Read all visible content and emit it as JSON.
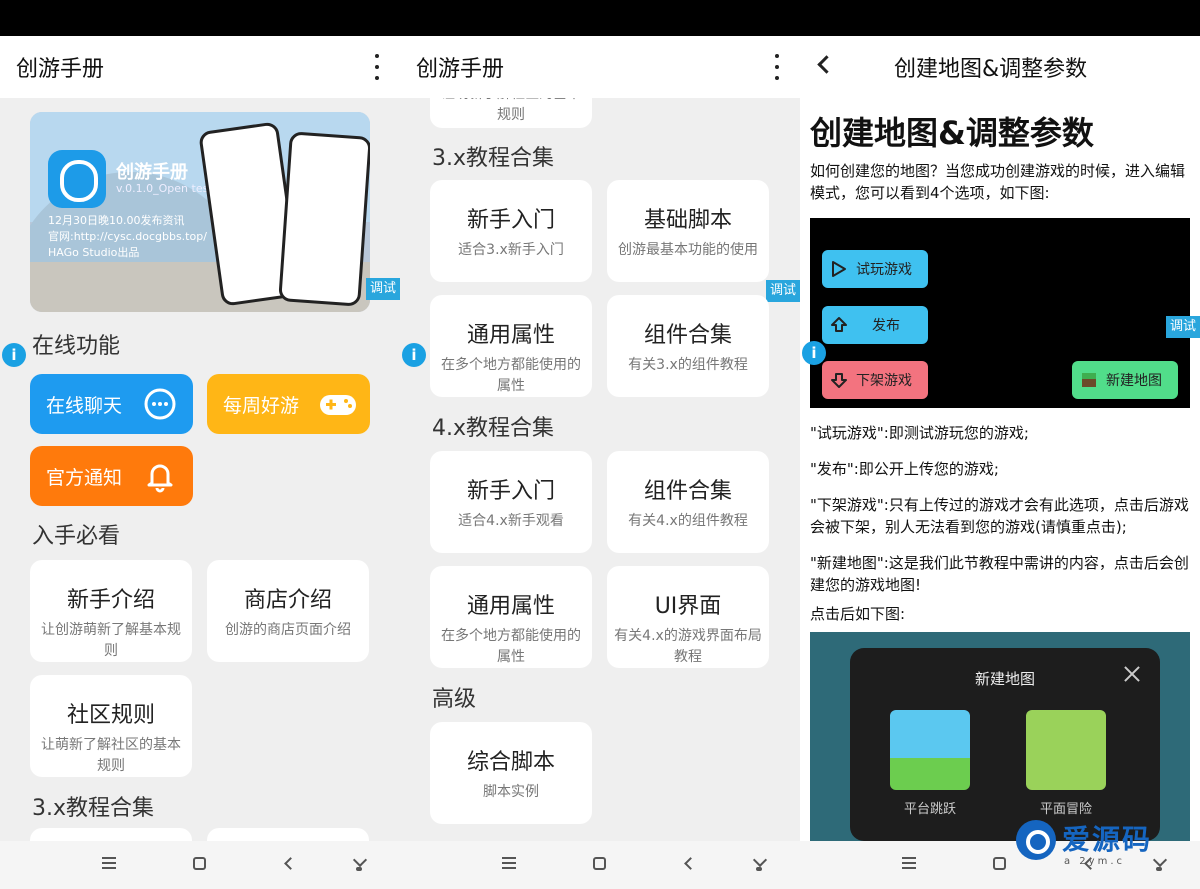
{
  "panel1": {
    "title": "创游手册",
    "banner": {
      "app_name": "创游手册",
      "version": "v.0.1.0_Open test",
      "notice": "12月30日晚10.00发布资讯",
      "site": "官网:http://cysc.docgbbs.top/",
      "studio": "HAGo Studio出品"
    },
    "debug_tag": "调试",
    "online_title": "在线功能",
    "buttons": [
      {
        "label": "在线聊天",
        "color": "#1e9bf0"
      },
      {
        "label": "每周好游",
        "color": "#ffb616"
      },
      {
        "label": "官方通知",
        "color": "#ff7a0c"
      }
    ],
    "must_see_title": "入手必看",
    "cards": [
      {
        "title": "新手介绍",
        "sub": "让创游萌新了解基本规则"
      },
      {
        "title": "商店介绍",
        "sub": "创游的商店页面介绍"
      },
      {
        "title": "社区规则",
        "sub": "让萌新了解社区的基本规则"
      }
    ],
    "next_title": "3.x教程合集"
  },
  "panel2": {
    "title": "创游手册",
    "top_partial": "让萌新了解社区的基本规则",
    "debug_tag": "调试",
    "sections": [
      {
        "title": "3.x教程合集",
        "cards": [
          {
            "title": "新手入门",
            "sub": "适合3.x新手入门"
          },
          {
            "title": "基础脚本",
            "sub": "创游最基本功能的使用"
          },
          {
            "title": "通用属性",
            "sub": "在多个地方都能使用的属性"
          },
          {
            "title": "组件合集",
            "sub": "有关3.x的组件教程"
          }
        ]
      },
      {
        "title": "4.x教程合集",
        "cards": [
          {
            "title": "新手入门",
            "sub": "适合4.x新手观看"
          },
          {
            "title": "组件合集",
            "sub": "有关4.x的组件教程"
          },
          {
            "title": "通用属性",
            "sub": "在多个地方都能使用的属性"
          },
          {
            "title": "UI界面",
            "sub": "有关4.x的游戏界面布局教程"
          }
        ]
      },
      {
        "title": "高级",
        "cards": [
          {
            "title": "综合脚本",
            "sub": "脚本实例"
          }
        ]
      }
    ]
  },
  "panel3": {
    "title": "创建地图&调整参数",
    "heading": "创建地图&调整参数",
    "debug_tag": "调试",
    "intro": "如何创建您的地图？当您成功创建游戏的时候，进入编辑模式，您可以看到4个选项，如下图:",
    "game_buttons": [
      {
        "label": "试玩游戏",
        "color": "#3fc1f0"
      },
      {
        "label": "发布",
        "color": "#3fc1f0"
      },
      {
        "label": "下架游戏",
        "color": "#f3737f"
      },
      {
        "label": "新建地图",
        "color": "#51dd8a"
      }
    ],
    "items": [
      "\"试玩游戏\":即测试游玩您的游戏;",
      "\"发布\":即公开上传您的游戏;",
      "\"下架游戏\":只有上传过的游戏才会有此选项，点击后游戏会被下架，别人无法看到您的游戏(请慎重点击);",
      "\"新建地图\":这是我们此节教程中需讲的内容，点击后会创建您的游戏地图!",
      "点击后如下图:"
    ],
    "dialog": {
      "title": "新建地图",
      "options": [
        "平台跳跃",
        "平面冒险"
      ]
    }
  },
  "watermark": {
    "text": "爱源码",
    "url": "a 2ym.c"
  }
}
